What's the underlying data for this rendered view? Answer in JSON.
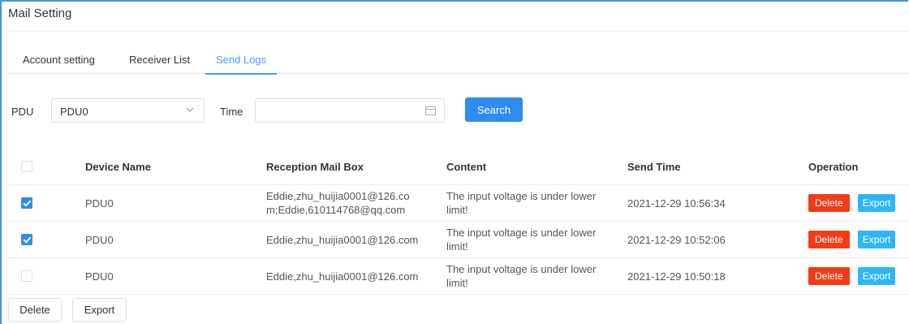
{
  "header": {
    "title": "Mail Setting"
  },
  "tabs": [
    {
      "label": "Account setting",
      "active": false
    },
    {
      "label": "Receiver List",
      "active": false
    },
    {
      "label": "Send Logs",
      "active": true
    }
  ],
  "filter": {
    "pdu_label": "PDU",
    "pdu_value": "PDU0",
    "time_label": "Time",
    "time_value": "",
    "search_label": "Search"
  },
  "table": {
    "headers": [
      "Device Name",
      "Reception Mail Box",
      "Content",
      "Send Time",
      "Operation"
    ],
    "rows": [
      {
        "checked": true,
        "device": "PDU0",
        "mailbox": "Eddie,zhu_huijia0001@126.co m;Eddie,610114768@qq.com",
        "content": "The input voltage is under lower limit!",
        "time": "2021-12-29 10:56:34",
        "delete": "Delete",
        "export": "Export"
      },
      {
        "checked": true,
        "device": "PDU0",
        "mailbox": "Eddie,zhu_huijia0001@126.com",
        "content": "The input voltage is under lower limit!",
        "time": "2021-12-29 10:52:06",
        "delete": "Delete",
        "export": "Export"
      },
      {
        "checked": false,
        "device": "PDU0",
        "mailbox": "Eddie,zhu_huijia0001@126.com",
        "content": "The input voltage is under lower limit!",
        "time": "2021-12-29 10:50:18",
        "delete": "Delete",
        "export": "Export"
      }
    ]
  },
  "footer": {
    "delete_label": "Delete",
    "export_label": "Export"
  },
  "colors": {
    "accent": "#409eff",
    "primary_button": "#2d8cf0",
    "danger": "#f03c17",
    "info": "#2db7f5"
  }
}
